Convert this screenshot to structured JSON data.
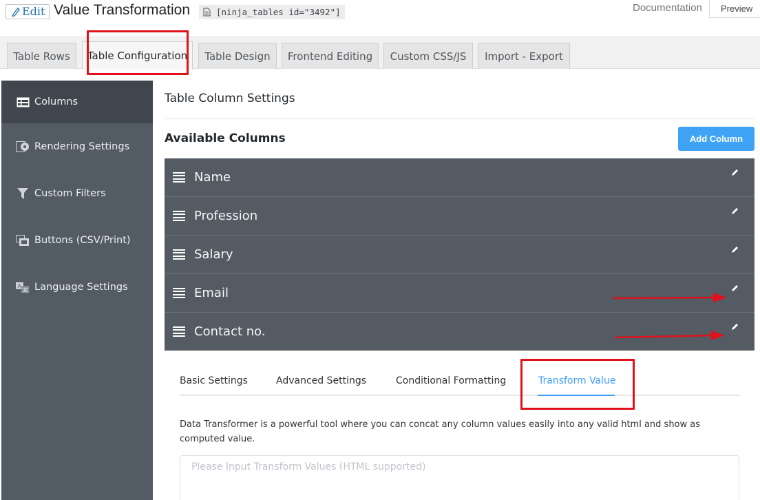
{
  "header": {
    "edit_label": "Edit",
    "title": "Value Transformation",
    "shortcode": "[ninja_tables id=\"3492\"]",
    "documentation": "Documentation",
    "preview": "Preview"
  },
  "tabs": [
    {
      "label": "Table Rows"
    },
    {
      "label": "Table Configuration",
      "active": true
    },
    {
      "label": "Table Design"
    },
    {
      "label": "Frontend Editing"
    },
    {
      "label": "Custom CSS/JS"
    },
    {
      "label": "Import - Export"
    }
  ],
  "sidebar": {
    "items": [
      {
        "label": "Columns",
        "icon": "table-icon",
        "active": true
      },
      {
        "label": "Rendering Settings",
        "icon": "rendering-icon"
      },
      {
        "label": "Custom Filters",
        "icon": "filter-icon"
      },
      {
        "label": "Buttons (CSV/Print)",
        "icon": "buttons-icon"
      },
      {
        "label": "Language Settings",
        "icon": "language-icon"
      }
    ]
  },
  "main": {
    "section_title": "Table Column Settings",
    "available_title": "Available Columns",
    "add_column": "Add Column",
    "columns": [
      {
        "name": "Name"
      },
      {
        "name": "Profession"
      },
      {
        "name": "Salary"
      },
      {
        "name": "Email"
      },
      {
        "name": "Contact no."
      }
    ],
    "settings_tabs": [
      {
        "label": "Basic Settings"
      },
      {
        "label": "Advanced Settings"
      },
      {
        "label": "Conditional Formatting"
      },
      {
        "label": "Transform Value",
        "active": true
      }
    ],
    "description": "Data Transformer is a powerful tool where you can concat any column values easily into any valid html and show as computed value.",
    "transform_placeholder": "Please Input Transform Values (HTML supported)"
  },
  "colors": {
    "sidebar_bg": "#535b64",
    "column_row_bg": "#545b63",
    "accent": "#409eff",
    "add_button": "#3fa3f5",
    "highlight": "#e0111b"
  }
}
